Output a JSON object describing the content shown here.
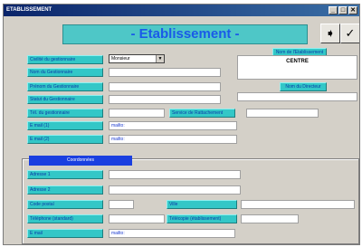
{
  "window": {
    "title": "ETABLISSEMENT",
    "controls": [
      "_",
      "□",
      "✕"
    ]
  },
  "header": {
    "title": "- Etablissement -",
    "nav_icon": "arrow-right-icon",
    "check_icon": "checkmark-icon"
  },
  "form": {
    "civilite": {
      "label": "Civilité du gestionnaire",
      "value": "Monsieur"
    },
    "nom_gest": {
      "label": "Nom du Gestionnaire",
      "value": ""
    },
    "prenom_gest": {
      "label": "Prénom du Gestionnaire",
      "value": ""
    },
    "statut_gest": {
      "label": "Statut du Gestionnaire",
      "value": ""
    },
    "tel_gest": {
      "label": "Tél. du gestionnaire",
      "value": ""
    },
    "service": {
      "label": "Service de Rattachement",
      "value": ""
    },
    "email1": {
      "label": "E mail (1)",
      "value": "mailto:"
    },
    "email2": {
      "label": "E mail (2)",
      "value": "mailto:"
    },
    "nom_etab": {
      "label": "Nom de l'Etablissement",
      "value": "CENTRE"
    },
    "nom_dir": {
      "label": "Nom du Directeur",
      "value": ""
    }
  },
  "coord": {
    "title": "Coordonnées",
    "adresse1": {
      "label": "Adresse 1",
      "value": ""
    },
    "adresse2": {
      "label": "Adresse 2",
      "value": ""
    },
    "code_postal": {
      "label": "Code postal",
      "value": ""
    },
    "ville": {
      "label": "Ville",
      "value": ""
    },
    "telephone": {
      "label": "Téléphone (standard)",
      "value": ""
    },
    "telecopie": {
      "label": "Télécopie (établissement)",
      "value": ""
    },
    "email": {
      "label": "E mail",
      "value": "mailto:"
    }
  }
}
